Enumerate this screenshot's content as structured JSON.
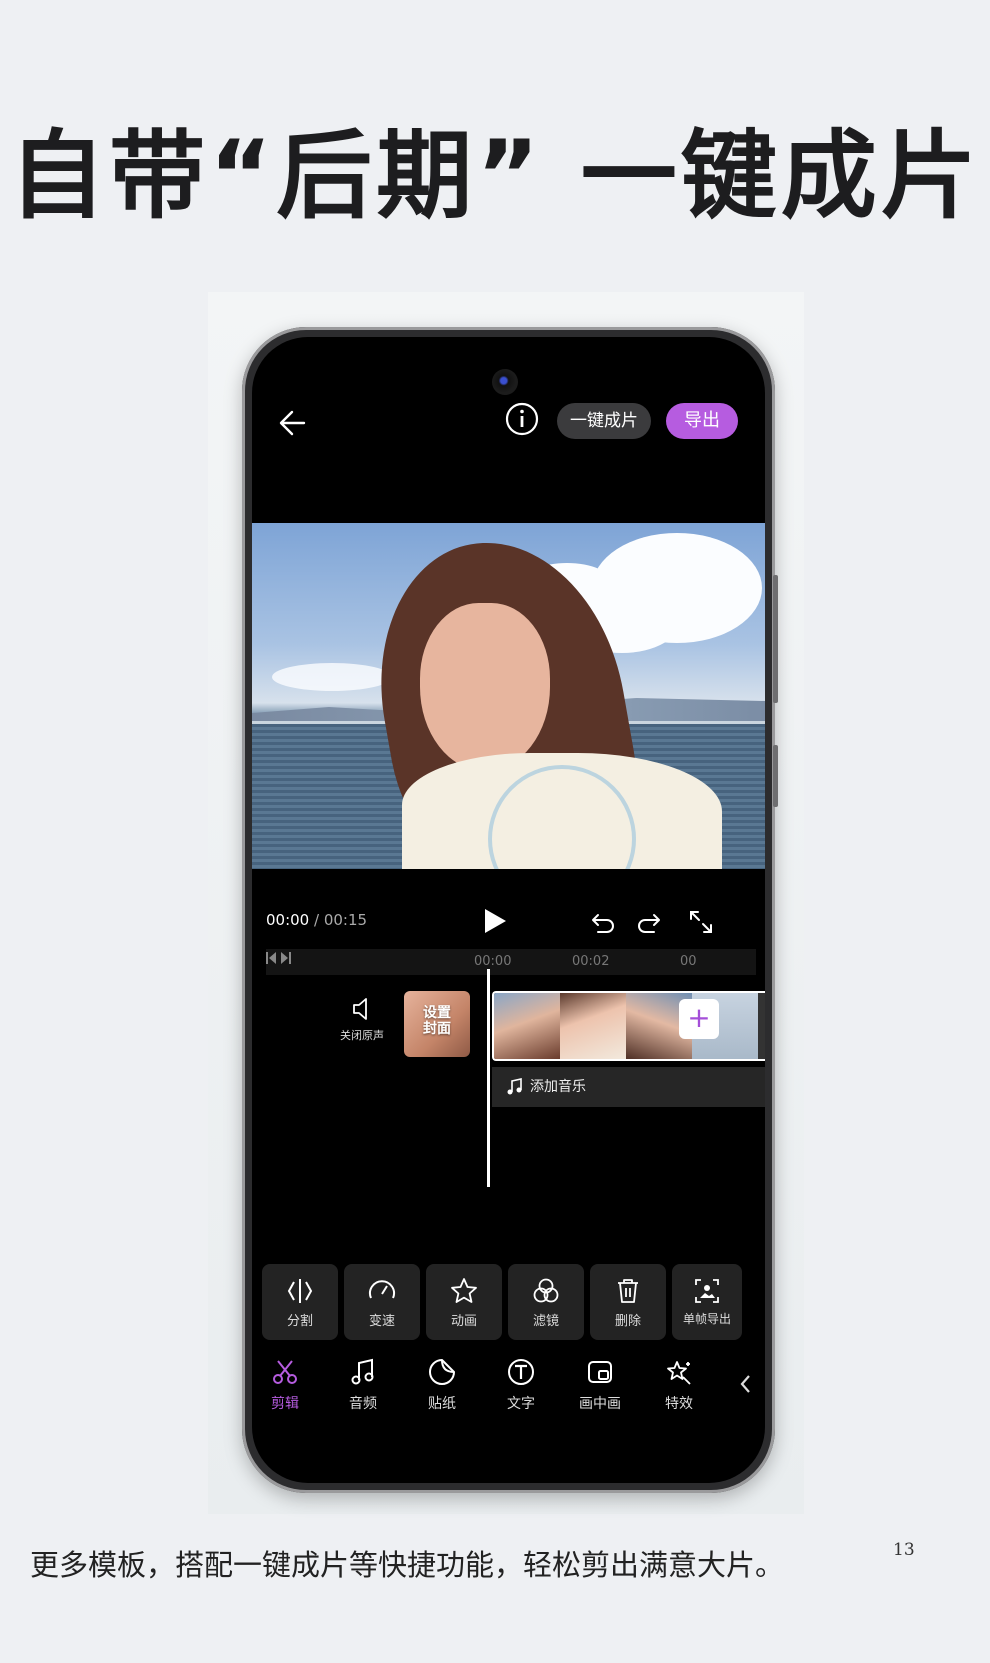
{
  "headline": "自带“后期” 一键成片",
  "caption": "更多模板，搭配一键成片等快捷功能，轻松剪出满意大片。",
  "page_number": "13",
  "top_bar": {
    "oneclick_label": "一键成片",
    "export_label": "导出"
  },
  "player": {
    "current_time": "00:00",
    "separator": " / ",
    "total_time": "00:15"
  },
  "ruler": {
    "marks": [
      "00:00",
      "00:02",
      "00"
    ]
  },
  "timeline": {
    "mute_label": "关闭原声",
    "cover_line1": "设置",
    "cover_line2": "封面",
    "add_music_label": "添加音乐"
  },
  "tools": [
    {
      "label": "分割",
      "icon": "split-icon"
    },
    {
      "label": "变速",
      "icon": "speed-icon"
    },
    {
      "label": "动画",
      "icon": "star-icon"
    },
    {
      "label": "滤镜",
      "icon": "filter-icon"
    },
    {
      "label": "删除",
      "icon": "trash-icon"
    },
    {
      "label": "单帧导出",
      "icon": "frame-export-icon"
    }
  ],
  "tabs": [
    {
      "label": "剪辑",
      "icon": "scissors-icon",
      "active": true
    },
    {
      "label": "音频",
      "icon": "music-note-icon"
    },
    {
      "label": "贴纸",
      "icon": "sticker-icon"
    },
    {
      "label": "文字",
      "icon": "text-icon"
    },
    {
      "label": "画中画",
      "icon": "pip-icon"
    },
    {
      "label": "特效",
      "icon": "effects-icon"
    }
  ],
  "colors": {
    "accent": "#b65ce0",
    "screen_bg": "#000000",
    "page_bg": "#eef0f3"
  }
}
